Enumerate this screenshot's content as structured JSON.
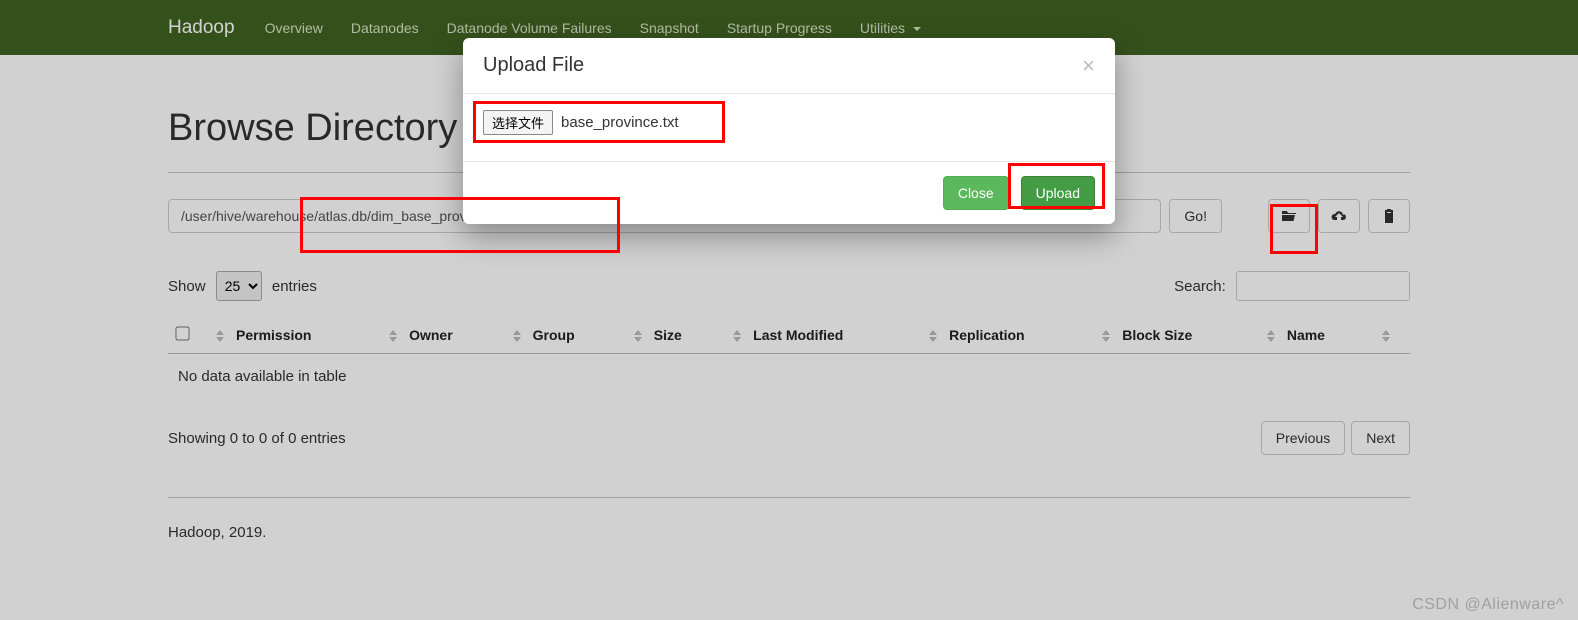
{
  "nav": {
    "brand": "Hadoop",
    "items": [
      "Overview",
      "Datanodes",
      "Datanode Volume Failures",
      "Snapshot",
      "Startup Progress",
      "Utilities"
    ]
  },
  "page": {
    "title": "Browse Directory",
    "path": "/user/hive/warehouse/atlas.db/dim_base_province",
    "go": "Go!",
    "show_prefix": "Show",
    "show_value": "25",
    "show_suffix": "entries",
    "search_label": "Search:",
    "empty_text": "No data available in table",
    "status": "Showing 0 to 0 of 0 entries",
    "prev": "Previous",
    "next": "Next",
    "copyright": "Hadoop, 2019."
  },
  "columns": [
    "Permission",
    "Owner",
    "Group",
    "Size",
    "Last Modified",
    "Replication",
    "Block Size",
    "Name"
  ],
  "modal": {
    "title": "Upload File",
    "choose": "选择文件",
    "filename": "base_province.txt",
    "close": "Close",
    "upload": "Upload"
  },
  "watermark": "CSDN @Alienware^"
}
